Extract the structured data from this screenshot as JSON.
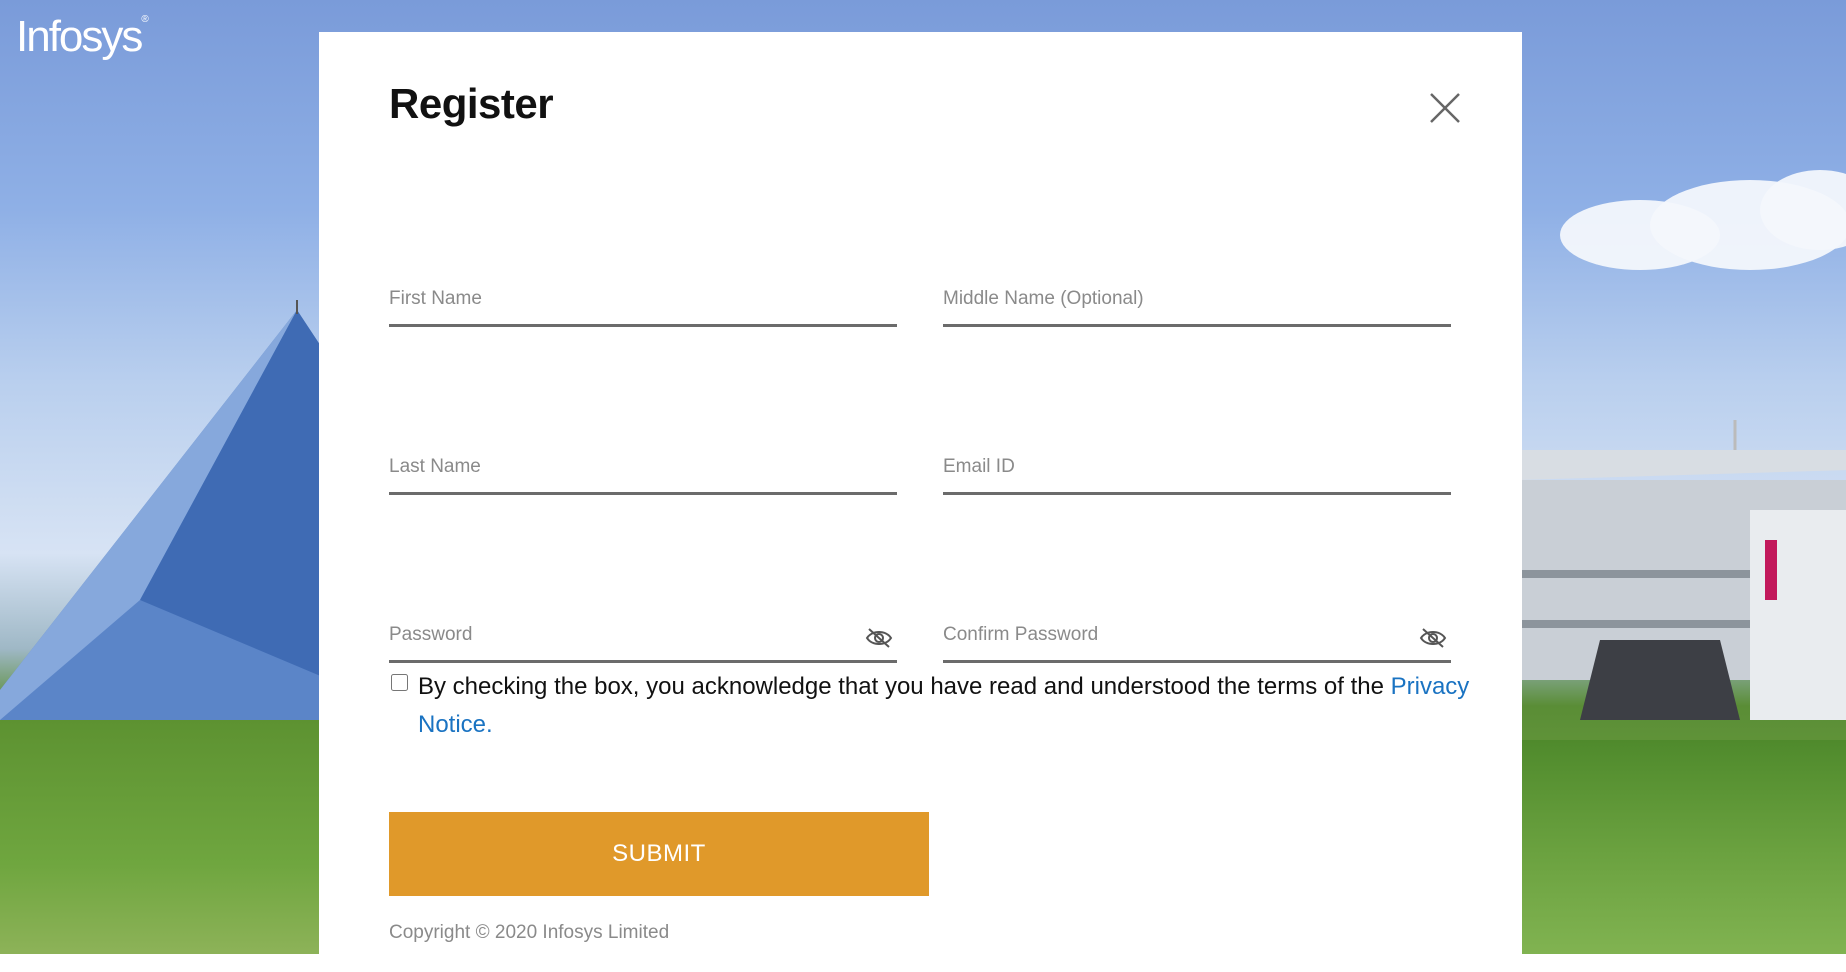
{
  "brand": {
    "logo_text": "Infosys",
    "logo_mark": "®"
  },
  "form": {
    "title": "Register",
    "fields": {
      "first_name": {
        "placeholder": "First Name",
        "value": ""
      },
      "middle_name": {
        "placeholder": "Middle Name (Optional)",
        "value": ""
      },
      "last_name": {
        "placeholder": "Last Name",
        "value": ""
      },
      "email": {
        "placeholder": "Email ID",
        "value": ""
      },
      "password": {
        "placeholder": "Password",
        "value": ""
      },
      "confirm_password": {
        "placeholder": "Confirm Password",
        "value": ""
      }
    },
    "consent": {
      "text": "By checking the box, you acknowledge that you have read and understood the terms of the ",
      "link_text": "Privacy Notice.",
      "checked": false
    },
    "submit_label": "SUBMIT",
    "copyright": "Copyright © 2020 Infosys Limited"
  },
  "icons": {
    "close": "close-icon",
    "password_toggle": "eye-slash-icon"
  },
  "colors": {
    "accent": "#e0992a",
    "link": "#1a73c2",
    "field_border": "#6b6b6b",
    "placeholder": "#8a8a8a"
  }
}
